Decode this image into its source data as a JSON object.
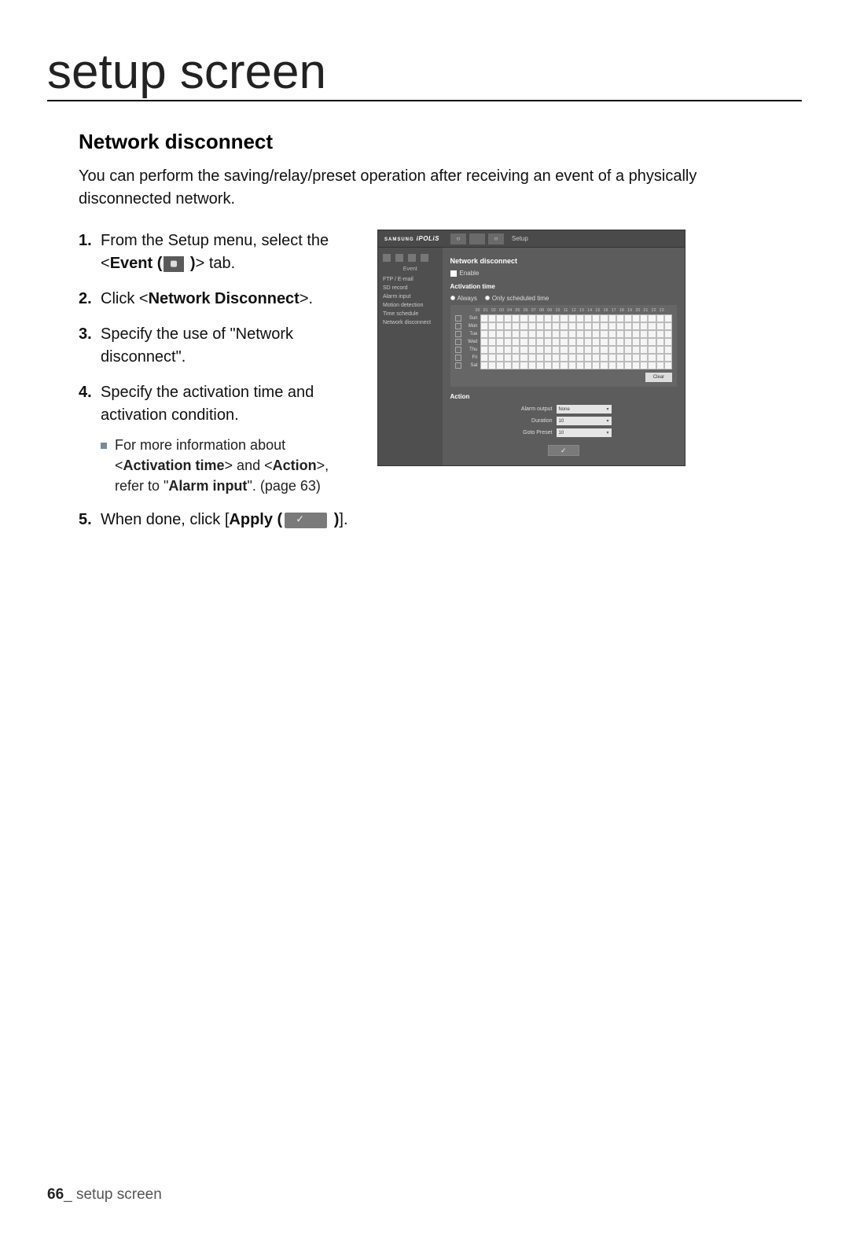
{
  "page": {
    "title": "setup screen",
    "section_title": "Network disconnect",
    "intro": "You can perform the saving/relay/preset operation after receiving an event of a physically disconnected network.",
    "footer_page": "66",
    "footer_text": "_ setup screen"
  },
  "steps": {
    "s1_a": "From the Setup menu, select the <",
    "s1_b": "Event (",
    "s1_c": " )",
    "s1_d": "> tab.",
    "s2_a": "Click <",
    "s2_b": "Network Disconnect",
    "s2_c": ">.",
    "s3": "Specify the use of \"Network disconnect\".",
    "s4": "Specify the activation time and activation condition.",
    "s4_sub_a": "For more information about <",
    "s4_sub_b": "Activation time",
    "s4_sub_c": "> and <",
    "s4_sub_d": "Action",
    "s4_sub_e": ">, refer to \"",
    "s4_sub_f": "Alarm input",
    "s4_sub_g": "\". (page 63)",
    "s5_a": "When done, click [",
    "s5_b": "Apply (",
    "s5_c": " )",
    "s5_d": "]."
  },
  "screenshot": {
    "brand_pre": "SAMSUNG",
    "brand": "iPOLiS",
    "top_setup": "Setup",
    "sidebar_title": "Event",
    "sidebar_items": [
      "FTP / E-mail",
      "SD record",
      "Alarm input",
      "Motion detection",
      "Time schedule",
      "Network disconnect"
    ],
    "panel_title": "Network disconnect",
    "enable_label": "Enable",
    "activation_title": "Activation time",
    "radio_always": "Always",
    "radio_sched": "Only scheduled time",
    "hours": [
      "00",
      "01",
      "02",
      "03",
      "04",
      "05",
      "06",
      "07",
      "08",
      "09",
      "10",
      "11",
      "12",
      "13",
      "14",
      "15",
      "16",
      "17",
      "18",
      "19",
      "20",
      "21",
      "22",
      "23"
    ],
    "days": [
      "Sun",
      "Mon",
      "Tue",
      "Wed",
      "Thu",
      "Fri",
      "Sat"
    ],
    "clear": "Clear",
    "action_title": "Action",
    "act_alarm_label": "Alarm output",
    "act_alarm_value": "None",
    "act_duration_label": "Duration",
    "act_duration_value": "10",
    "act_goto_label": "Goto Preset",
    "act_goto_value": "10",
    "apply_check": "✓"
  }
}
